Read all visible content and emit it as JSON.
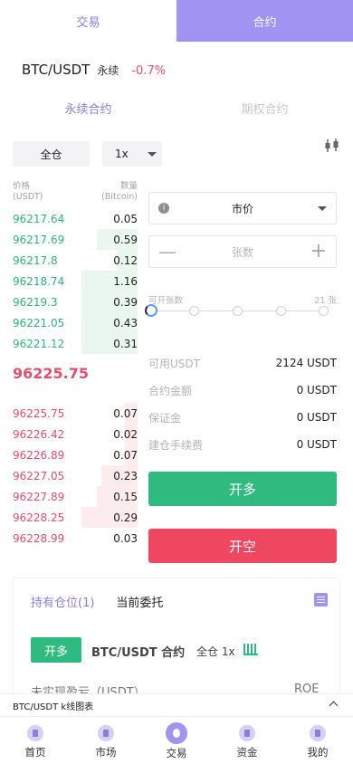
{
  "top_tabs": {
    "trade": "交易",
    "contract": "合约"
  },
  "pair": {
    "symbol": "BTC/USDT",
    "kind": "永续",
    "change": "-0.7%"
  },
  "sub_tabs": {
    "perpetual": "永续合约",
    "options": "期权合约"
  },
  "controls": {
    "margin_mode": "全仓",
    "leverage": "1x"
  },
  "order_book": {
    "price_header": "价格",
    "price_unit": "(USDT)",
    "qty_header": "数量",
    "qty_unit": "(Bitcoin)",
    "asks": [
      {
        "price": "96217.64",
        "qty": "0.05",
        "depth": 0.0
      },
      {
        "price": "96217.69",
        "qty": "0.59",
        "depth": 0.72
      },
      {
        "price": "96217.8",
        "qty": "0.12",
        "depth": 0.37
      },
      {
        "price": "96218.74",
        "qty": "1.16",
        "depth": 1.0
      },
      {
        "price": "96219.3",
        "qty": "0.39",
        "depth": 1.0
      },
      {
        "price": "96221.05",
        "qty": "0.43",
        "depth": 1.0
      },
      {
        "price": "96221.12",
        "qty": "0.31",
        "depth": 1.0
      }
    ],
    "last_price": "96225.75",
    "bids": [
      {
        "price": "96225.75",
        "qty": "0.07",
        "depth": 0.22
      },
      {
        "price": "96226.42",
        "qty": "0.02",
        "depth": 0.22
      },
      {
        "price": "96226.89",
        "qty": "0.07",
        "depth": 0.22
      },
      {
        "price": "96227.05",
        "qty": "0.23",
        "depth": 0.65
      },
      {
        "price": "96227.89",
        "qty": "0.15",
        "depth": 0.72
      },
      {
        "price": "96228.25",
        "qty": "0.29",
        "depth": 1.0
      },
      {
        "price": "96228.99",
        "qty": "0.03",
        "depth": 0.0
      }
    ]
  },
  "order_form": {
    "order_type": "市价",
    "qty_placeholder": "张数",
    "slider_min_label": "可开张数",
    "slider_max_label": "21 张",
    "available_label": "可用USDT",
    "available_value": "2124 USDT",
    "amount_label": "合约金额",
    "amount_value": "0 USDT",
    "margin_label": "保证金",
    "margin_value": "0 USDT",
    "fee_label": "建仓手续费",
    "fee_value": "0 USDT",
    "long_button": "开多",
    "short_button": "开空"
  },
  "positions": {
    "tab_holdings": "持有仓位(1)",
    "tab_orders": "当前委托",
    "badge": "开多",
    "title": "BTC/USDT 合约",
    "mode": "全仓 1x",
    "pnl_label": "未实现盈亏（USDT）",
    "roe_label": "ROE"
  },
  "kline_bar": {
    "label": "BTC/USDT k线图表"
  },
  "bottom_nav": [
    {
      "label": "首页",
      "icon": "home-icon"
    },
    {
      "label": "市场",
      "icon": "market-icon"
    },
    {
      "label": "交易",
      "icon": "trade-icon"
    },
    {
      "label": "资金",
      "icon": "wallet-icon"
    },
    {
      "label": "我的",
      "icon": "profile-icon"
    }
  ],
  "colors": {
    "accent": "#9f94f2",
    "up": "#2fba80",
    "down": "#f04761"
  }
}
